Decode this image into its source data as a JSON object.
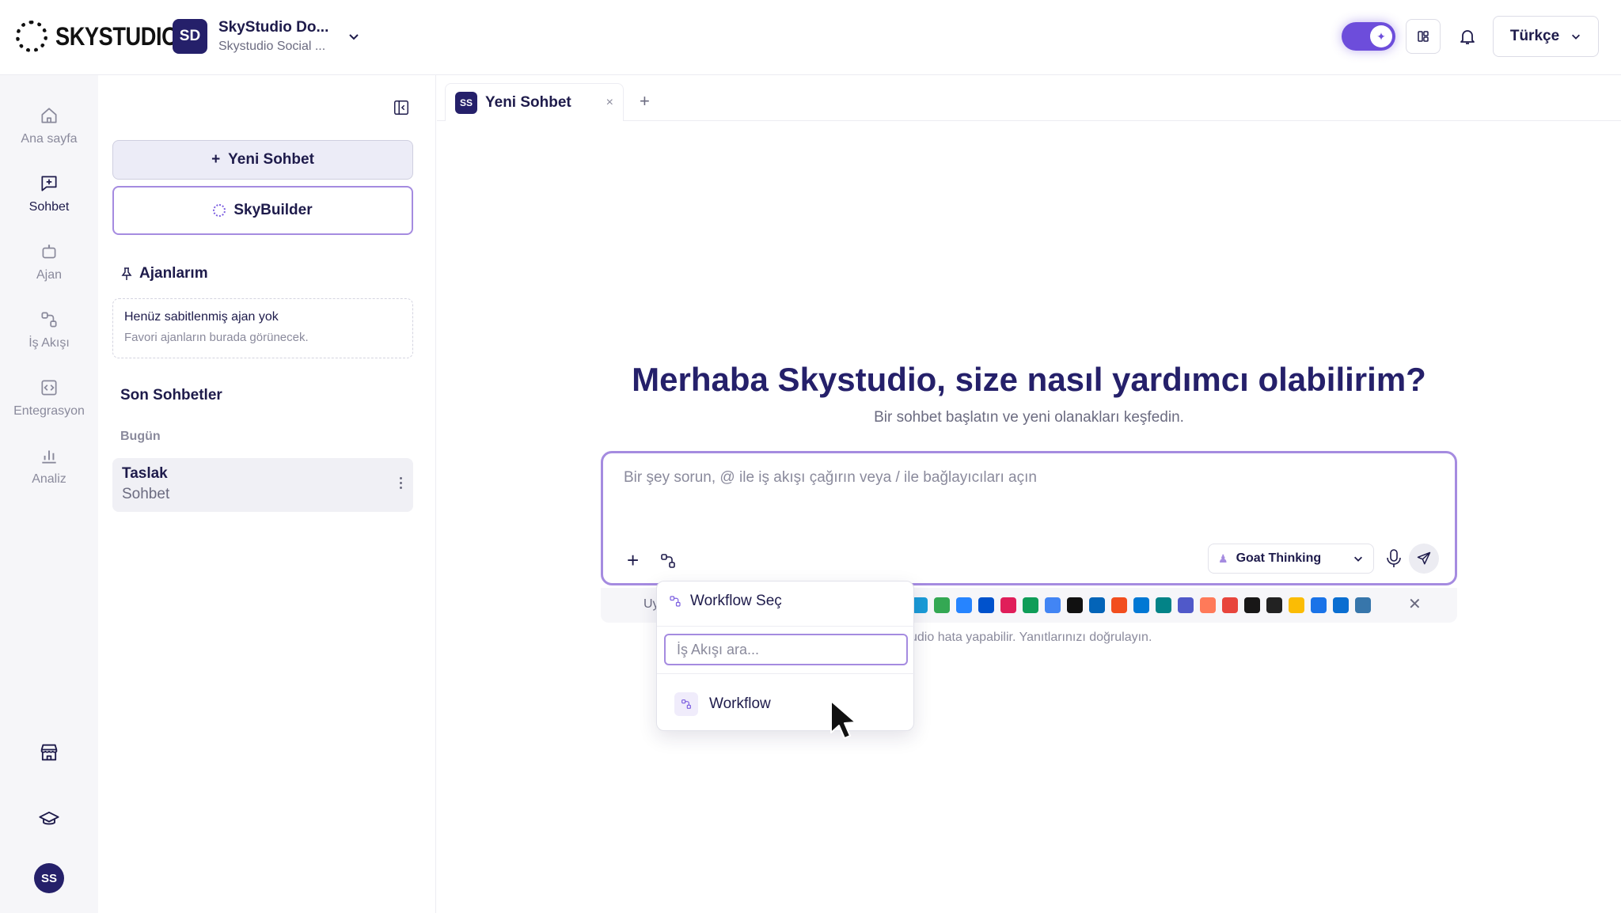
{
  "header": {
    "logo_text": "SKYSTUDIO",
    "workspace": {
      "avatar": "SD",
      "name": "SkyStudio Do...",
      "subtitle": "Skystudio Social ..."
    },
    "language": "Türkçe",
    "icons": {
      "toggle": "sparkle-icon",
      "layout": "grid-icon",
      "notifications": "bell-icon"
    }
  },
  "rail": {
    "items": [
      {
        "label": "Ana sayfa",
        "icon": "home-icon"
      },
      {
        "label": "Sohbet",
        "icon": "chat-plus-icon",
        "active": true
      },
      {
        "label": "Ajan",
        "icon": "robot-icon"
      },
      {
        "label": "İş Akışı",
        "icon": "workflow-icon"
      },
      {
        "label": "Entegrasyon",
        "icon": "code-icon"
      },
      {
        "label": "Analiz",
        "icon": "bar-chart-icon"
      }
    ],
    "bottom": {
      "store_icon": "store-icon",
      "learn_icon": "graduation-cap-icon",
      "avatar": "SS"
    }
  },
  "sidebar": {
    "new_chat": "Yeni Sohbet",
    "skybuilder": "SkyBuilder",
    "agents_title": "Ajanlarım",
    "agents_empty_title": "Henüz sabitlenmiş ajan yok",
    "agents_empty_sub": "Favori ajanların burada görünecek.",
    "recent_title": "Son Sohbetler",
    "day_label": "Bugün",
    "chats": [
      {
        "title": "Taslak",
        "subtitle": "Sohbet"
      }
    ]
  },
  "tabs": {
    "badge": "SS",
    "label": "Yeni Sohbet",
    "close": "×",
    "add": "+"
  },
  "main": {
    "title": "Merhaba Skystudio, size nasıl yardımcı olabilirim?",
    "subtitle": "Bir sohbet başlatın ve yeni olanakları keşfedin.",
    "composer_placeholder": "Bir şey sorun, @ ile iş akışı çağırın veya / ile bağlayıcıları açın",
    "model": "Goat Thinking",
    "integrations_prefix": "Uy",
    "disclaimer": "udio hata yapabilir. Yanıtlarınızı doğrulayın.",
    "integration_colors": [
      "#1a9bd7",
      "#34a853",
      "#2684ff",
      "#0052cc",
      "#e01e5a",
      "#0f9d58",
      "#4285f4",
      "#111111",
      "#0364b8",
      "#f24e1e",
      "#0078d4",
      "#038387",
      "#5059c9",
      "#ff7a59",
      "#e8453c",
      "#181717",
      "#222222",
      "#fbbc04",
      "#1a73e8",
      "#0a6ed1",
      "#3776ab"
    ]
  },
  "dropdown": {
    "title": "Workflow Seç",
    "search_placeholder": "İş Akışı ara...",
    "items": [
      {
        "label": "Workflow"
      }
    ]
  },
  "colors": {
    "accent": "#6d4ddb",
    "brand_dark": "#25206a",
    "border_accent": "#a58be0"
  }
}
